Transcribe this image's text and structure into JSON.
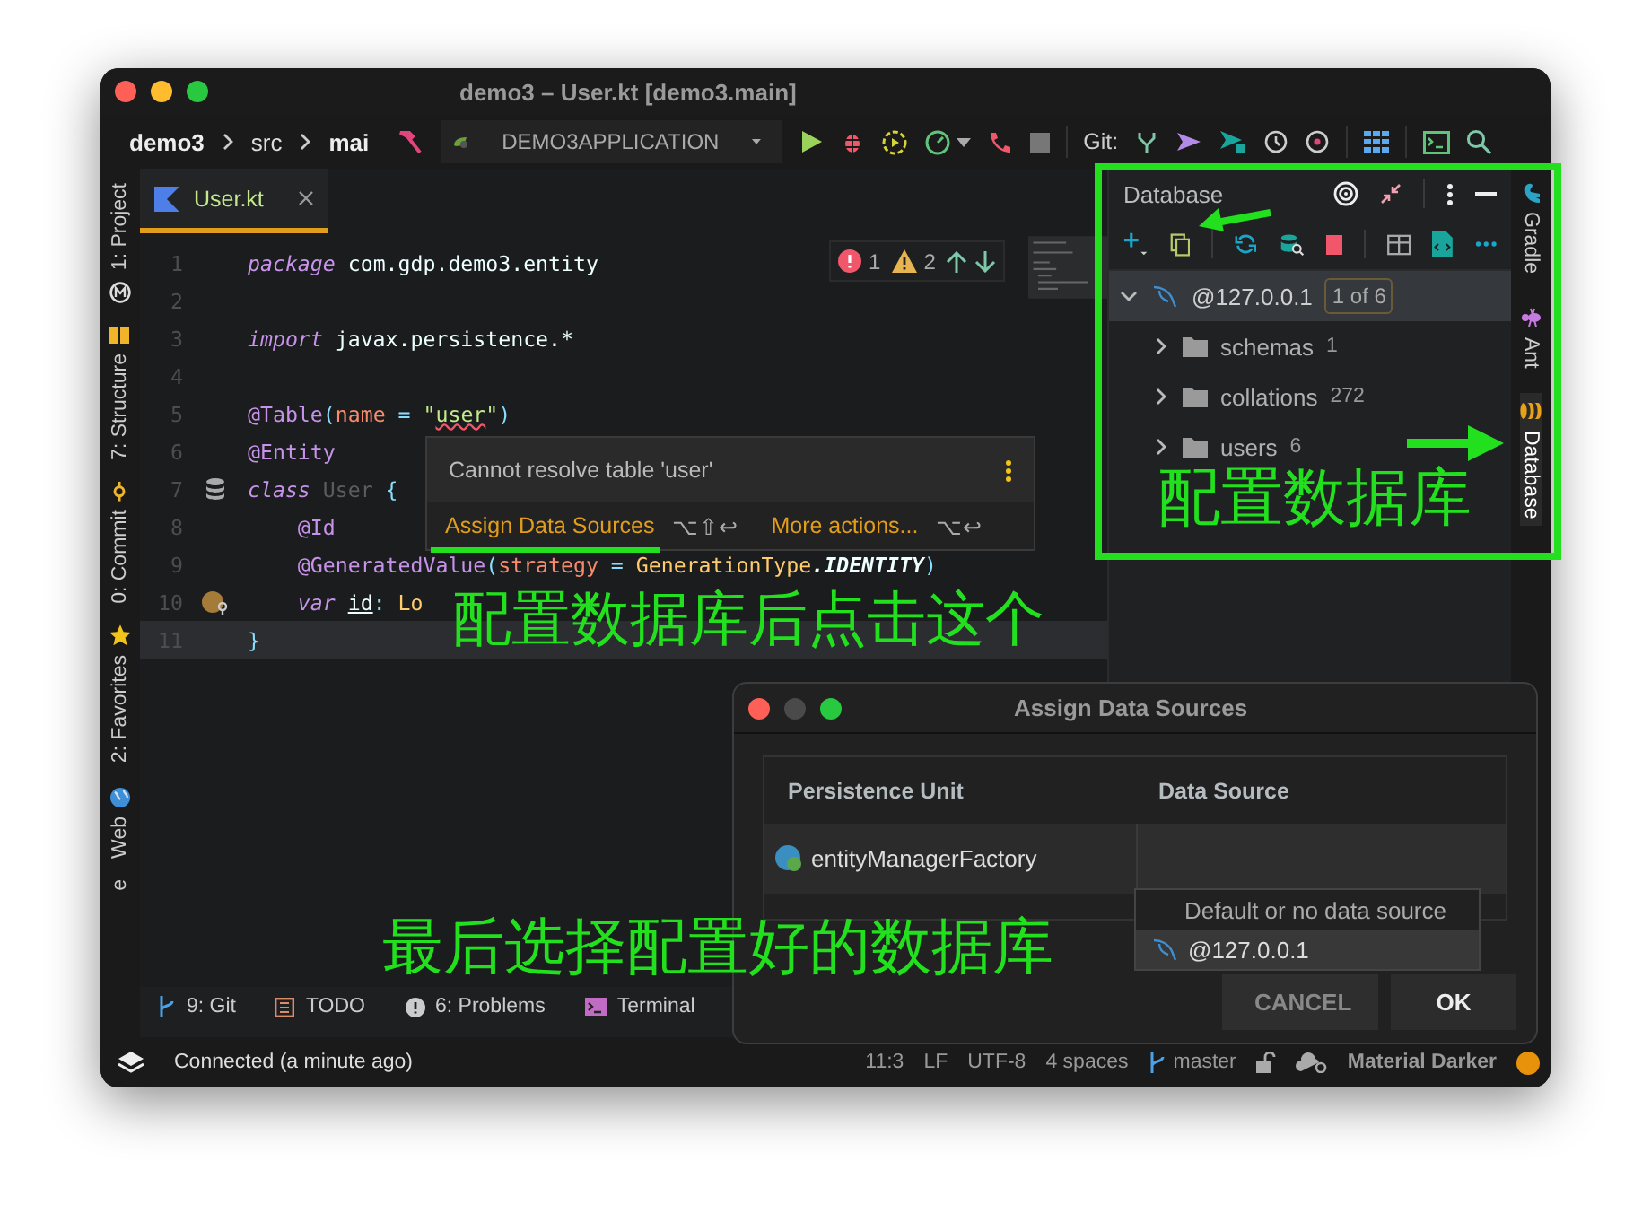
{
  "window": {
    "title": "demo3 – User.kt [demo3.main]"
  },
  "breadcrumbs": [
    "demo3",
    "src",
    "mai"
  ],
  "run_config": {
    "label": "DEMO3APPLICATION"
  },
  "toolbar": {
    "git_label": "Git:"
  },
  "left_tool_windows": [
    {
      "label": "1: Project",
      "kind": "project"
    },
    {
      "label": "7: Structure",
      "kind": "structure"
    },
    {
      "label": "0: Commit",
      "kind": "commit"
    },
    {
      "label": "2: Favorites",
      "kind": "favorites"
    },
    {
      "label": "Web",
      "kind": "web"
    },
    {
      "label": "e",
      "kind": "plain"
    }
  ],
  "editor": {
    "tabs": [
      {
        "label": "User.kt",
        "selected": true
      }
    ],
    "inspections": {
      "errors": "1",
      "warnings": "2"
    },
    "lines": [
      {
        "number": "1",
        "current": false,
        "tokens": [
          {
            "text": "package",
            "kind": "keyword"
          },
          {
            "text": " com.gdp.demo3.entity",
            "kind": "plain"
          }
        ]
      },
      {
        "number": "2",
        "current": false
      },
      {
        "number": "3",
        "current": false,
        "tokens": [
          {
            "text": "import",
            "kind": "keyword"
          },
          {
            "text": " javax.persistence.*",
            "kind": "plain"
          }
        ]
      },
      {
        "number": "4",
        "current": false
      },
      {
        "number": "5",
        "current": false,
        "tokens": [
          {
            "text": "@Table",
            "kind": "annotation"
          },
          {
            "text": "(",
            "kind": "punct"
          },
          {
            "text": "name",
            "kind": "param"
          },
          {
            "text": " = ",
            "kind": "punct"
          },
          {
            "text": "\"",
            "kind": "string"
          },
          {
            "text": "user",
            "kind": "string_error"
          },
          {
            "text": "\"",
            "kind": "string"
          },
          {
            "text": ")",
            "kind": "punct"
          }
        ]
      },
      {
        "number": "6",
        "current": false,
        "tokens": [
          {
            "text": "@Entity",
            "kind": "annotation"
          }
        ]
      },
      {
        "number": "7",
        "current": false,
        "marker": {
          "kind": "database"
        },
        "tokens": [
          {
            "text": "class ",
            "kind": "keyword"
          },
          {
            "text": "User",
            "kind": "dim"
          },
          {
            "text": " {",
            "kind": "punct"
          }
        ]
      },
      {
        "number": "8",
        "current": false,
        "tokens": [
          {
            "text": "    @Id",
            "kind": "annotation"
          }
        ]
      },
      {
        "number": "9",
        "current": false,
        "tokens": [
          {
            "text": "    @GeneratedValue",
            "kind": "annotation"
          },
          {
            "text": "(",
            "kind": "punct"
          },
          {
            "text": "strategy",
            "kind": "param"
          },
          {
            "text": " = ",
            "kind": "punct"
          },
          {
            "text": "GenerationType",
            "kind": "type"
          },
          {
            "text": ".IDENTITY",
            "kind": "constant"
          },
          {
            "text": ")",
            "kind": "punct"
          }
        ]
      },
      {
        "number": "10",
        "current": false,
        "marker": {
          "kind": "field"
        },
        "tokens": [
          {
            "text": "    var ",
            "kind": "keyword"
          },
          {
            "text": "id",
            "kind": "unused"
          },
          {
            "text": ": ",
            "kind": "punct"
          },
          {
            "text": "Lo",
            "kind": "type"
          }
        ]
      },
      {
        "number": "11",
        "current": true,
        "tokens": [
          {
            "text": "}",
            "kind": "punct"
          }
        ]
      }
    ]
  },
  "intention_popup": {
    "message": "Cannot resolve table 'user'",
    "actions": [
      {
        "label": "Assign Data Sources",
        "shortcut": "⌥⇧↩"
      },
      {
        "label": "More actions...",
        "shortcut": "⌥↩"
      }
    ]
  },
  "database_panel": {
    "title": "Database",
    "tree": [
      {
        "label": "@127.0.0.1",
        "badge": "1 of 6",
        "expanded": true,
        "selected": true,
        "children": [
          {
            "label": "schemas",
            "count": "1",
            "expanded": false,
            "selected": false
          },
          {
            "label": "collations",
            "count": "272",
            "expanded": false,
            "selected": false
          },
          {
            "label": "users",
            "count": "6",
            "expanded": false,
            "selected": false
          }
        ]
      }
    ]
  },
  "right_tool_windows": [
    {
      "label": "Gradle",
      "kind": "gradle",
      "selected": false
    },
    {
      "label": "Ant",
      "kind": "ant",
      "selected": false
    },
    {
      "label": "Database",
      "kind": "database",
      "selected": true
    }
  ],
  "bottom_tool_windows": [
    {
      "label": "9: Git",
      "kind": "git"
    },
    {
      "label": "TODO",
      "kind": "todo"
    },
    {
      "label": "6: Problems",
      "kind": "problems"
    },
    {
      "label": "Terminal",
      "kind": "terminal"
    }
  ],
  "status_bar": {
    "message": "Connected (a minute ago)",
    "items": [
      "11:3",
      "LF",
      "UTF-8",
      "4 spaces"
    ],
    "branch": "master",
    "theme": "Material Darker"
  },
  "dialog": {
    "title": "Assign Data Sources",
    "columns": [
      "Persistence Unit",
      "Data Source"
    ],
    "rows": [
      {
        "unit": "entityManagerFactory"
      }
    ],
    "dropdown": [
      {
        "label": "Default or no data source",
        "selected": false
      },
      {
        "label": "@127.0.0.1",
        "selected": true
      }
    ],
    "buttons": [
      {
        "label": "CANCEL",
        "kind": "secondary"
      },
      {
        "label": "OK",
        "kind": "primary"
      }
    ]
  },
  "annotations": [
    {
      "text": "配置数据库",
      "kind": "panel"
    },
    {
      "text": "配置数据库后点击这个",
      "kind": "popup"
    },
    {
      "text": "最后选择配置好的数据库",
      "kind": "dialog"
    }
  ]
}
